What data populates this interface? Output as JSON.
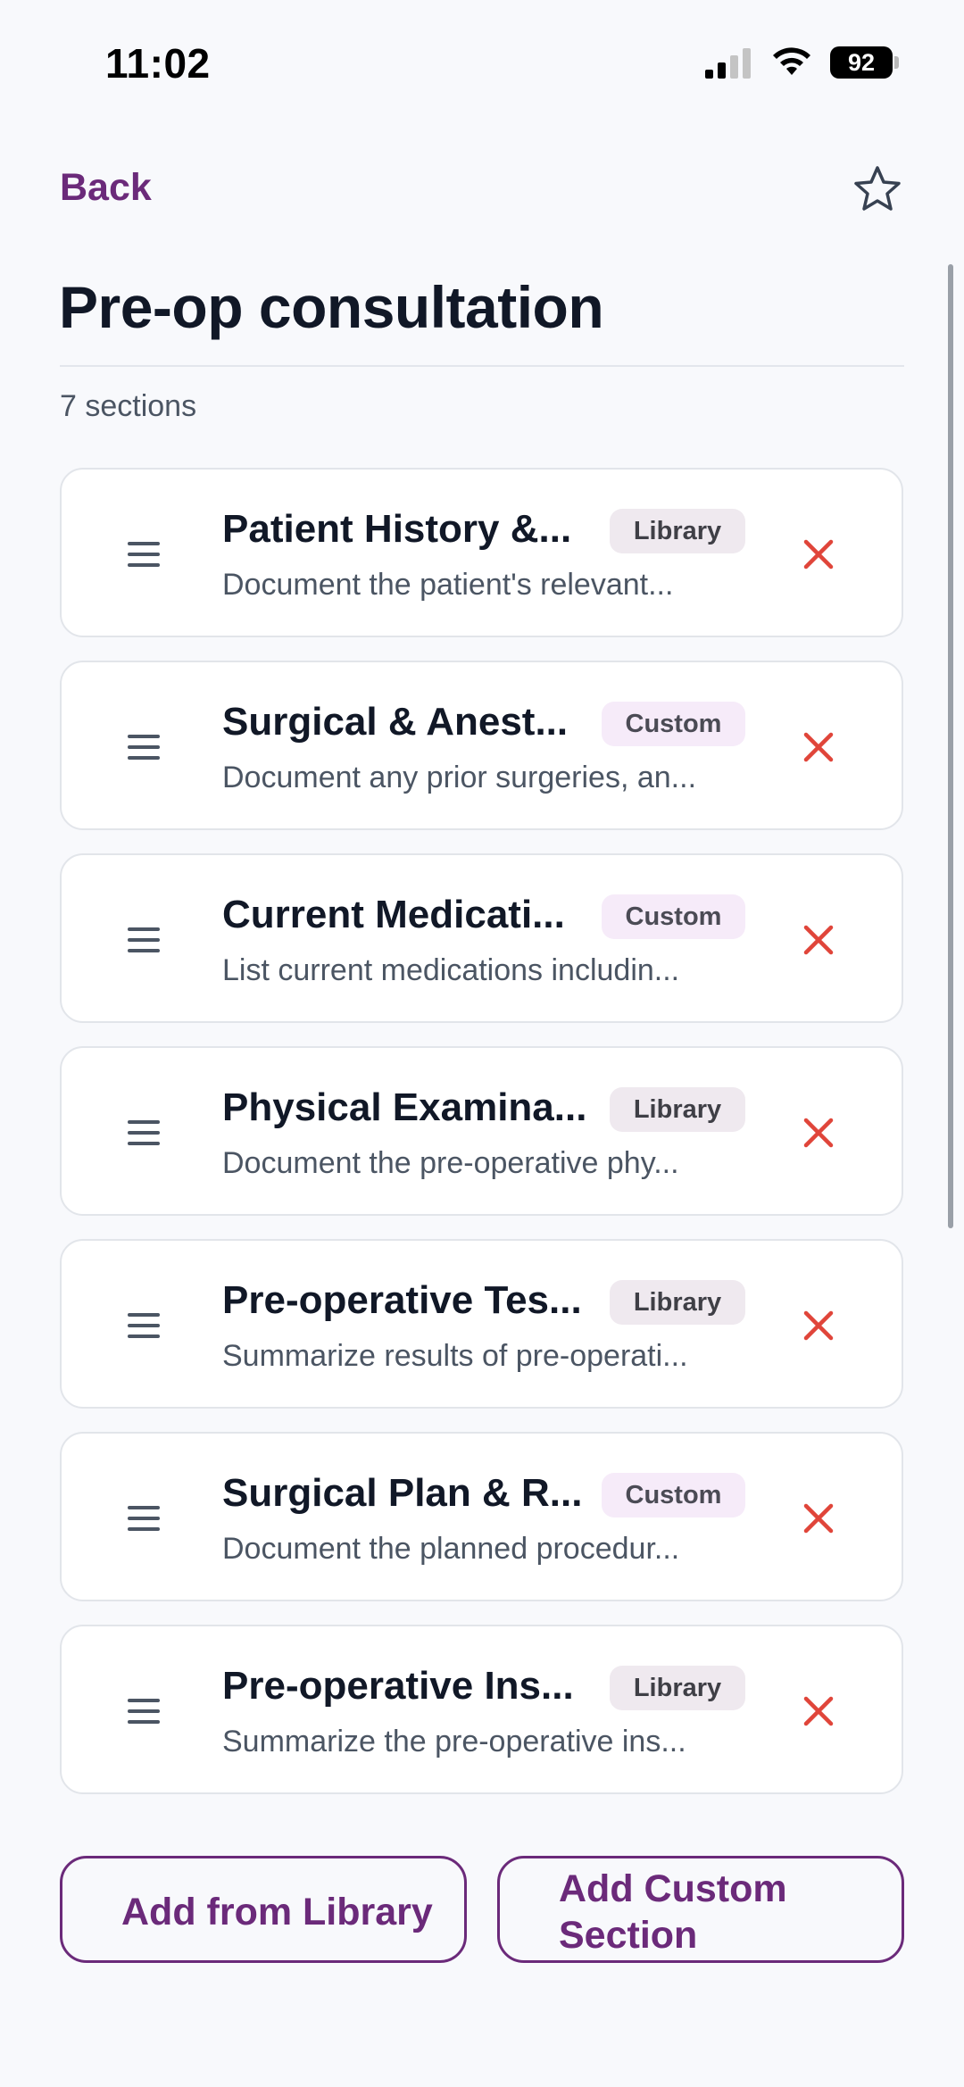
{
  "status_bar": {
    "time": "11:02",
    "battery": "92"
  },
  "nav": {
    "back_label": "Back"
  },
  "page": {
    "title": "Pre-op consultation",
    "section_count": "7 sections"
  },
  "sections": [
    {
      "title": "Patient History &...",
      "badge": "Library",
      "description": "Document the patient's relevant..."
    },
    {
      "title": "Surgical & Anest...",
      "badge": "Custom",
      "description": "Document any prior surgeries, an..."
    },
    {
      "title": "Current Medicati...",
      "badge": "Custom",
      "description": "List current medications includin..."
    },
    {
      "title": "Physical Examina...",
      "badge": "Library",
      "description": "Document the pre-operative phy..."
    },
    {
      "title": "Pre-operative Tes...",
      "badge": "Library",
      "description": "Summarize results of pre-operati..."
    },
    {
      "title": "Surgical Plan & R...",
      "badge": "Custom",
      "description": "Document the planned procedur..."
    },
    {
      "title": "Pre-operative Ins...",
      "badge": "Library",
      "description": "Summarize the pre-operative ins..."
    }
  ],
  "actions": {
    "add_from_library": "Add from Library",
    "add_custom_section": "Add Custom Section"
  },
  "colors": {
    "accent": "#6b2a7a",
    "remove": "#e0453a",
    "background": "#f8f9fc"
  },
  "icons": {
    "favorite": "star-outline-icon",
    "drag": "drag-handle-icon",
    "remove": "close-icon"
  }
}
